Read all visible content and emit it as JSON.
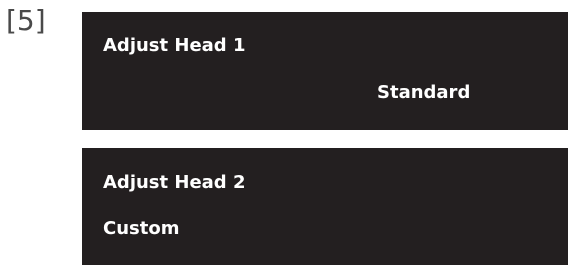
{
  "step_label": "[5]",
  "panels": [
    {
      "title": "Adjust Head 1",
      "value": "Standard"
    },
    {
      "title": "Adjust Head 2",
      "value": "Custom"
    }
  ]
}
